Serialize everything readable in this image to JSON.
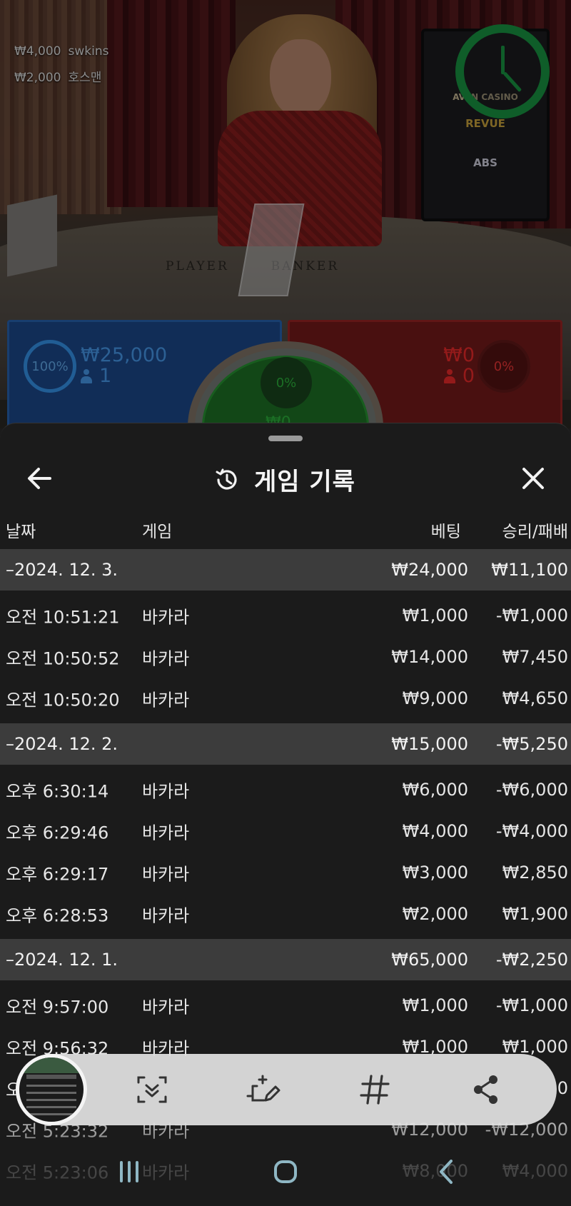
{
  "video": {
    "feed": [
      {
        "amount": "₩4,000",
        "user": "swkins"
      },
      {
        "amount": "₩2,000",
        "user": "호스맨"
      }
    ],
    "table_text": "PLAYER       BANKER",
    "monitor_brands": [
      "AVEN CASINO",
      "REVUE",
      "ABS"
    ],
    "player": {
      "percent": "100%",
      "amount": "₩25,000",
      "count": "1"
    },
    "banker": {
      "percent": "0%",
      "amount": "₩0",
      "count": "0"
    },
    "tie": {
      "percent": "0%",
      "amount": "₩0"
    }
  },
  "sheet": {
    "title": "게임 기록",
    "columns": {
      "date": "날짜",
      "game": "게임",
      "bet": "베팅",
      "win_loss": "승리/패배"
    },
    "groups": [
      {
        "date": "–2024. 12. 3.",
        "bet": "₩24,000",
        "win_loss": "₩11,100",
        "rows": [
          {
            "time": "오전 10:51:21",
            "game": "바카라",
            "bet": "₩1,000",
            "win_loss": "-₩1,000"
          },
          {
            "time": "오전 10:50:52",
            "game": "바카라",
            "bet": "₩14,000",
            "win_loss": "₩7,450"
          },
          {
            "time": "오전 10:50:20",
            "game": "바카라",
            "bet": "₩9,000",
            "win_loss": "₩4,650"
          }
        ]
      },
      {
        "date": "–2024. 12. 2.",
        "bet": "₩15,000",
        "win_loss": "-₩5,250",
        "rows": [
          {
            "time": "오후 6:30:14",
            "game": "바카라",
            "bet": "₩6,000",
            "win_loss": "-₩6,000"
          },
          {
            "time": "오후 6:29:46",
            "game": "바카라",
            "bet": "₩4,000",
            "win_loss": "-₩4,000"
          },
          {
            "time": "오후 6:29:17",
            "game": "바카라",
            "bet": "₩3,000",
            "win_loss": "₩2,850"
          },
          {
            "time": "오후 6:28:53",
            "game": "바카라",
            "bet": "₩2,000",
            "win_loss": "₩1,900"
          }
        ]
      },
      {
        "date": "–2024. 12. 1.",
        "bet": "₩65,000",
        "win_loss": "-₩2,250",
        "rows": [
          {
            "time": "오전 9:57:00",
            "game": "바카라",
            "bet": "₩1,000",
            "win_loss": "-₩1,000"
          },
          {
            "time": "오전 9:56:32",
            "game": "바카라",
            "bet": "₩1,000",
            "win_loss": "₩1,000"
          },
          {
            "time": "오전 ",
            "game": "",
            "bet": "",
            "win_loss": "0"
          },
          {
            "time": "오전 5:23:32",
            "game": "바카라",
            "bet": "₩12,000",
            "win_loss": "-₩12,000"
          },
          {
            "time": "오전 5:23:06",
            "game": "바카라",
            "bet": "₩8,000",
            "win_loss": "₩4,000"
          }
        ]
      }
    ]
  },
  "toolbar": {
    "icons": [
      "screenshot-thumbnail",
      "scroll-capture-icon",
      "edit-icon",
      "hashtag-icon",
      "share-icon"
    ],
    "hashtag_glyph": "#"
  },
  "colors": {
    "player_blue": "#1e4e96",
    "banker_red": "#7e1c1c",
    "tie_green": "#1f7b28",
    "timer_green": "#1aa048",
    "sheet_bg": "#1b1b1b",
    "group_header_bg": "#3c3c3c"
  }
}
